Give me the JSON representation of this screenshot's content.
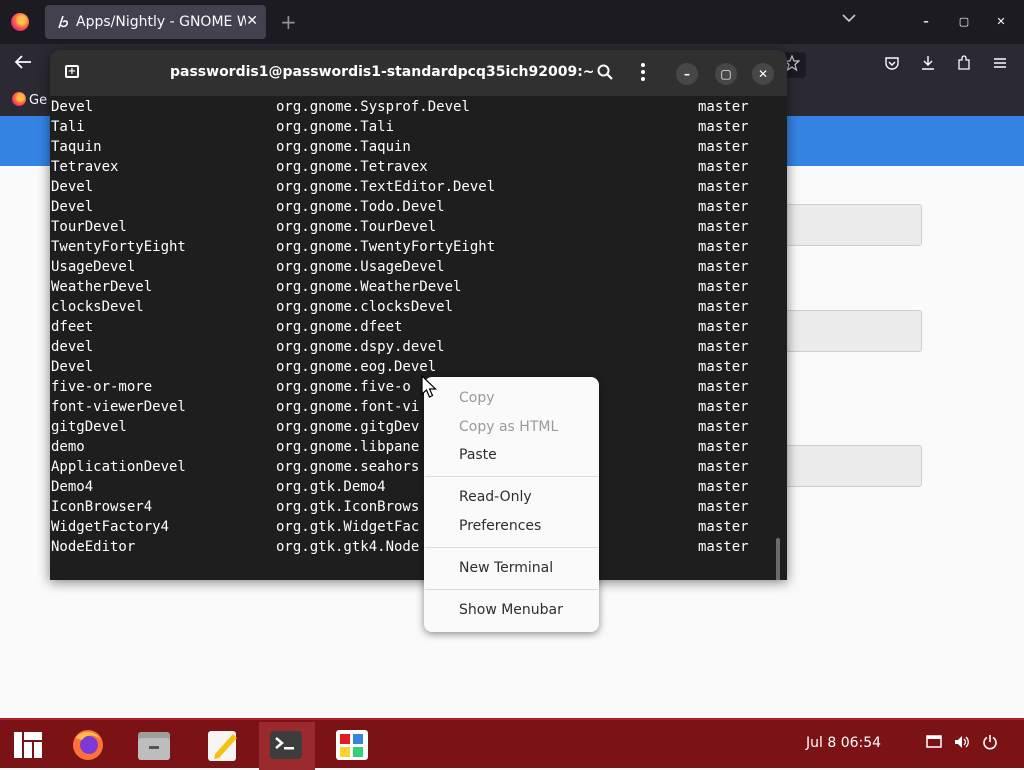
{
  "browser": {
    "tab_title": "Apps/Nightly - GNOME W",
    "tab_close": "✕",
    "new_tab": "+",
    "bookmark_label": "Ge",
    "window_min": "–",
    "window_max": "▢",
    "window_close": "✕"
  },
  "terminal": {
    "title": "passwordis1@passwordis1-standardpcq35ich92009:~",
    "new_tab_glyph": "+",
    "rows": [
      [
        "Devel",
        "org.gnome.Sysprof.Devel",
        "master"
      ],
      [
        "Tali",
        "org.gnome.Tali",
        "master"
      ],
      [
        "Taquin",
        "org.gnome.Taquin",
        "master"
      ],
      [
        "Tetravex",
        "org.gnome.Tetravex",
        "master"
      ],
      [
        "Devel",
        "org.gnome.TextEditor.Devel",
        "master"
      ],
      [
        "Devel",
        "org.gnome.Todo.Devel",
        "master"
      ],
      [
        "TourDevel",
        "org.gnome.TourDevel",
        "master"
      ],
      [
        "TwentyFortyEight",
        "org.gnome.TwentyFortyEight",
        "master"
      ],
      [
        "UsageDevel",
        "org.gnome.UsageDevel",
        "master"
      ],
      [
        "WeatherDevel",
        "org.gnome.WeatherDevel",
        "master"
      ],
      [
        "clocksDevel",
        "org.gnome.clocksDevel",
        "master"
      ],
      [
        "dfeet",
        "org.gnome.dfeet",
        "master"
      ],
      [
        "devel",
        "org.gnome.dspy.devel",
        "master"
      ],
      [
        "Devel",
        "org.gnome.eog.Devel",
        "master"
      ],
      [
        "five-or-more",
        "org.gnome.five-o",
        "master"
      ],
      [
        "font-viewerDevel",
        "org.gnome.font-vi",
        "master"
      ],
      [
        "gitgDevel",
        "org.gnome.gitgDev",
        "master"
      ],
      [
        "demo",
        "org.gnome.libpane",
        "master"
      ],
      [
        "ApplicationDevel",
        "org.gnome.seahors",
        "master"
      ],
      [
        "Demo4",
        "org.gtk.Demo4",
        "master"
      ],
      [
        "IconBrowser4",
        "org.gtk.IconBrows",
        "master"
      ],
      [
        "WidgetFactory4",
        "org.gtk.WidgetFac",
        "master"
      ],
      [
        "NodeEditor",
        "org.gtk.gtk4.Node",
        "master"
      ]
    ],
    "prompt": {
      "home_glyph": "⌂ ~",
      "status_glyph": "✓"
    }
  },
  "context_menu": {
    "copy": "Copy",
    "copy_html": "Copy as HTML",
    "paste": "Paste",
    "read_only": "Read-Only",
    "preferences": "Preferences",
    "new_terminal": "New Terminal",
    "show_menubar": "Show Menubar"
  },
  "taskbar": {
    "clock": "Jul 8  06:54",
    "accent_color": "#7a1216",
    "apps": [
      "menu-icon",
      "firefox-icon",
      "files-icon",
      "text-editor-icon",
      "terminal-icon",
      "software-icon"
    ]
  }
}
